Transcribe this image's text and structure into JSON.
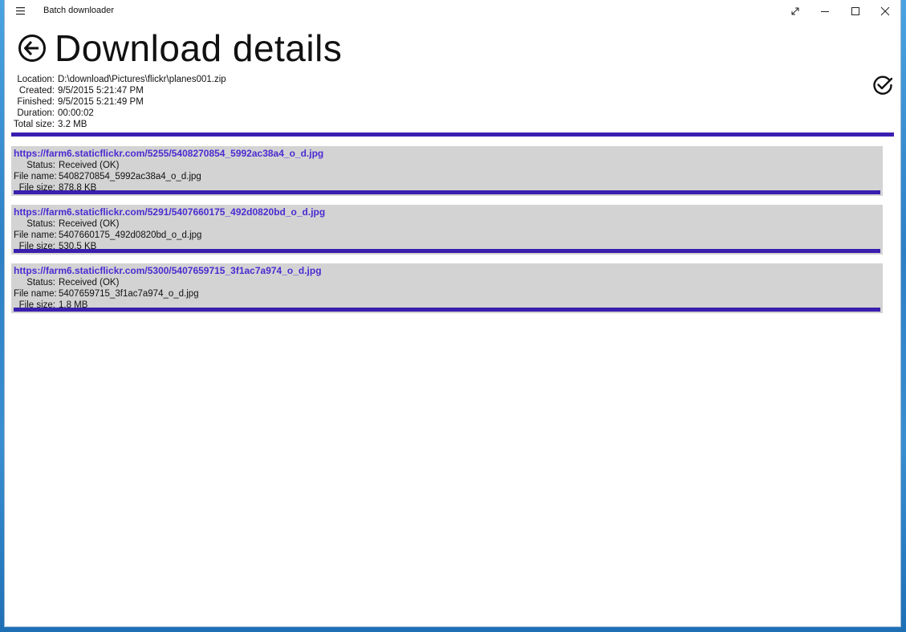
{
  "app": {
    "title": "Batch downloader"
  },
  "header": {
    "title": "Download details"
  },
  "summary": {
    "location_label": "Location:",
    "location_value": "D:\\download\\Pictures\\flickr\\planes001.zip",
    "created_label": "Created:",
    "created_value": "9/5/2015 5:21:47 PM",
    "finished_label": "Finished:",
    "finished_value": "9/5/2015 5:21:49 PM",
    "duration_label": "Duration:",
    "duration_value": "00:00:02",
    "total_size_label": "Total size:",
    "total_size_value": "3.2 MB",
    "progress_fraction": 1.0
  },
  "labels": {
    "status": "Status:",
    "file_name": "File name:",
    "file_size": "File size:"
  },
  "items": [
    {
      "url": "https://farm6.staticflickr.com/5255/5408270854_5992ac38a4_o_d.jpg",
      "status": "Received (OK)",
      "file_name": "5408270854_5992ac38a4_o_d.jpg",
      "file_size": "878.8 KB",
      "progress_fraction": 1.0
    },
    {
      "url": "https://farm6.staticflickr.com/5291/5407660175_492d0820bd_o_d.jpg",
      "status": "Received (OK)",
      "file_name": "5407660175_492d0820bd_o_d.jpg",
      "file_size": "530.5 KB",
      "progress_fraction": 1.0
    },
    {
      "url": "https://farm6.staticflickr.com/5300/5407659715_3f1ac7a974_o_d.jpg",
      "status": "Received (OK)",
      "file_name": "5407659715_3f1ac7a974_o_d.jpg",
      "file_size": "1.8 MB",
      "progress_fraction": 1.0
    }
  ],
  "icons": {
    "menu": "hamburger-menu-icon",
    "back": "back-arrow-circle-icon",
    "done": "checkmark-circle-icon",
    "fullscreen": "fullscreen-icon",
    "minimize": "minimize-icon",
    "maximize": "maximize-icon",
    "close": "close-icon"
  },
  "colors": {
    "accent": "#3a1fae",
    "link": "#4b2bd1",
    "item_background": "#d3d3d3"
  }
}
